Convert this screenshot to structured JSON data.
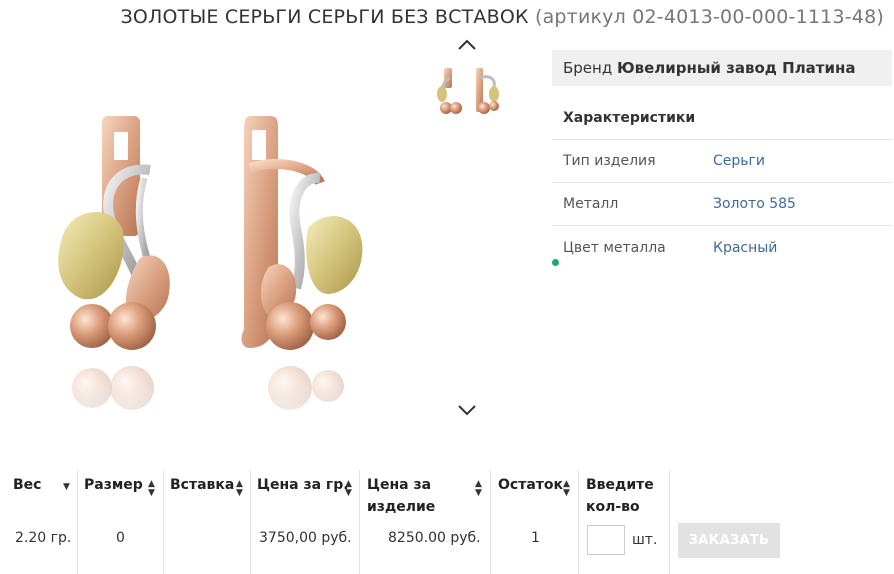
{
  "title": {
    "main": "ЗОЛОТЫЕ СЕРЬГИ СЕРЬГИ БЕЗ ВСТАВОК",
    "article": "(артикул 02-4013-00-000-1113-48)"
  },
  "brand": {
    "label": "Бренд",
    "value": "Ювелирный завод Платина"
  },
  "characteristics": {
    "heading": "Характеристики",
    "rows": [
      {
        "key": "Тип изделия",
        "value": "Серьги"
      },
      {
        "key": "Металл",
        "value": "Золото 585"
      },
      {
        "key": "Цвет металла",
        "value": "Красный"
      }
    ]
  },
  "table": {
    "headers": {
      "weight": "Вес",
      "size": "Размер",
      "insert": "Вставка",
      "price_per_gram_line": "Цена за гр.",
      "price_item_line1": "Цена за",
      "price_item_line2": "изделие",
      "stock": "Остаток",
      "qty_line1": "Введите",
      "qty_line2": "кол-во"
    },
    "row": {
      "weight": "2.20 гр.",
      "size": "0",
      "insert": "",
      "price_per_gram": "3750,00 руб.",
      "price_item": "8250.00 руб.",
      "stock": "1",
      "qty_value": "",
      "qty_unit": "шт."
    },
    "order_button": "ЗАКАЗАТЬ"
  },
  "colors": {
    "link": "#3d6aa0",
    "brand_bg": "#f0f0f0",
    "button_bg": "#e2e2e2",
    "status_dot": "#1aa57a"
  },
  "icons": {
    "up": "chevron-up-icon",
    "down": "chevron-down-icon",
    "sort": "sort-icon"
  }
}
